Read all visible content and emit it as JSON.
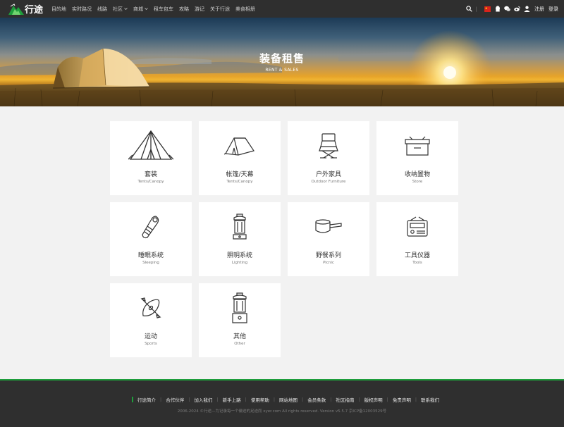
{
  "nav": {
    "logo_text": "行途",
    "menu": [
      {
        "label": "目的地",
        "dropdown": false
      },
      {
        "label": "实时路况",
        "dropdown": false
      },
      {
        "label": "线路",
        "dropdown": false
      },
      {
        "label": "社区",
        "dropdown": true
      },
      {
        "label": "商城",
        "dropdown": true
      },
      {
        "label": "租车包车",
        "dropdown": false
      },
      {
        "label": "攻略",
        "dropdown": false
      },
      {
        "label": "游记",
        "dropdown": false
      },
      {
        "label": "关于行途",
        "dropdown": false
      },
      {
        "label": "美食相册",
        "dropdown": false
      }
    ],
    "separator": "|",
    "register": "注册",
    "login": "登录",
    "icons": [
      "search-icon",
      "flag-icon",
      "qq-icon",
      "wechat-icon",
      "weibo-icon",
      "user-icon"
    ]
  },
  "banner": {
    "title": "装备租售",
    "subtitle": "RENT & SALES"
  },
  "categories": [
    {
      "cn": "套装",
      "en": "Tents/Canopy",
      "icon": "big-tent-icon"
    },
    {
      "cn": "帐篷/天幕",
      "en": "Tents/Canopy",
      "icon": "tent-icon"
    },
    {
      "cn": "户外家具",
      "en": "Outdoor Furniture",
      "icon": "camp-chair-icon"
    },
    {
      "cn": "收纳置物",
      "en": "Store",
      "icon": "storage-box-icon"
    },
    {
      "cn": "睡眠系统",
      "en": "Sleeping",
      "icon": "sleeping-bag-icon"
    },
    {
      "cn": "照明系统",
      "en": "Lighting",
      "icon": "lantern-icon"
    },
    {
      "cn": "野餐系列",
      "en": "Picnic",
      "icon": "cooking-pot-icon"
    },
    {
      "cn": "工具仪器",
      "en": "Tools",
      "icon": "radio-icon"
    },
    {
      "cn": "运动",
      "en": "Sports",
      "icon": "kayak-icon"
    },
    {
      "cn": "其他",
      "en": "Other",
      "icon": "gas-lantern-icon"
    }
  ],
  "footer": {
    "links": [
      "行途简介",
      "合作伙伴",
      "加入我们",
      "新手上路",
      "使用帮助",
      "网站地图",
      "会员条款",
      "社区指南",
      "版权声明",
      "免责声明",
      "联系我们"
    ],
    "copyright": "2006-2024 ©行途—为记录每一个徽途的足迹而 xyer.com All rights reserved. Version v5.5.7 京ICP备12003529号"
  },
  "colors": {
    "nav_bg": "#2f2f2f",
    "accent_green": "#1e9e3c",
    "page_bg": "#f2f2f2",
    "card_bg": "#ffffff"
  }
}
